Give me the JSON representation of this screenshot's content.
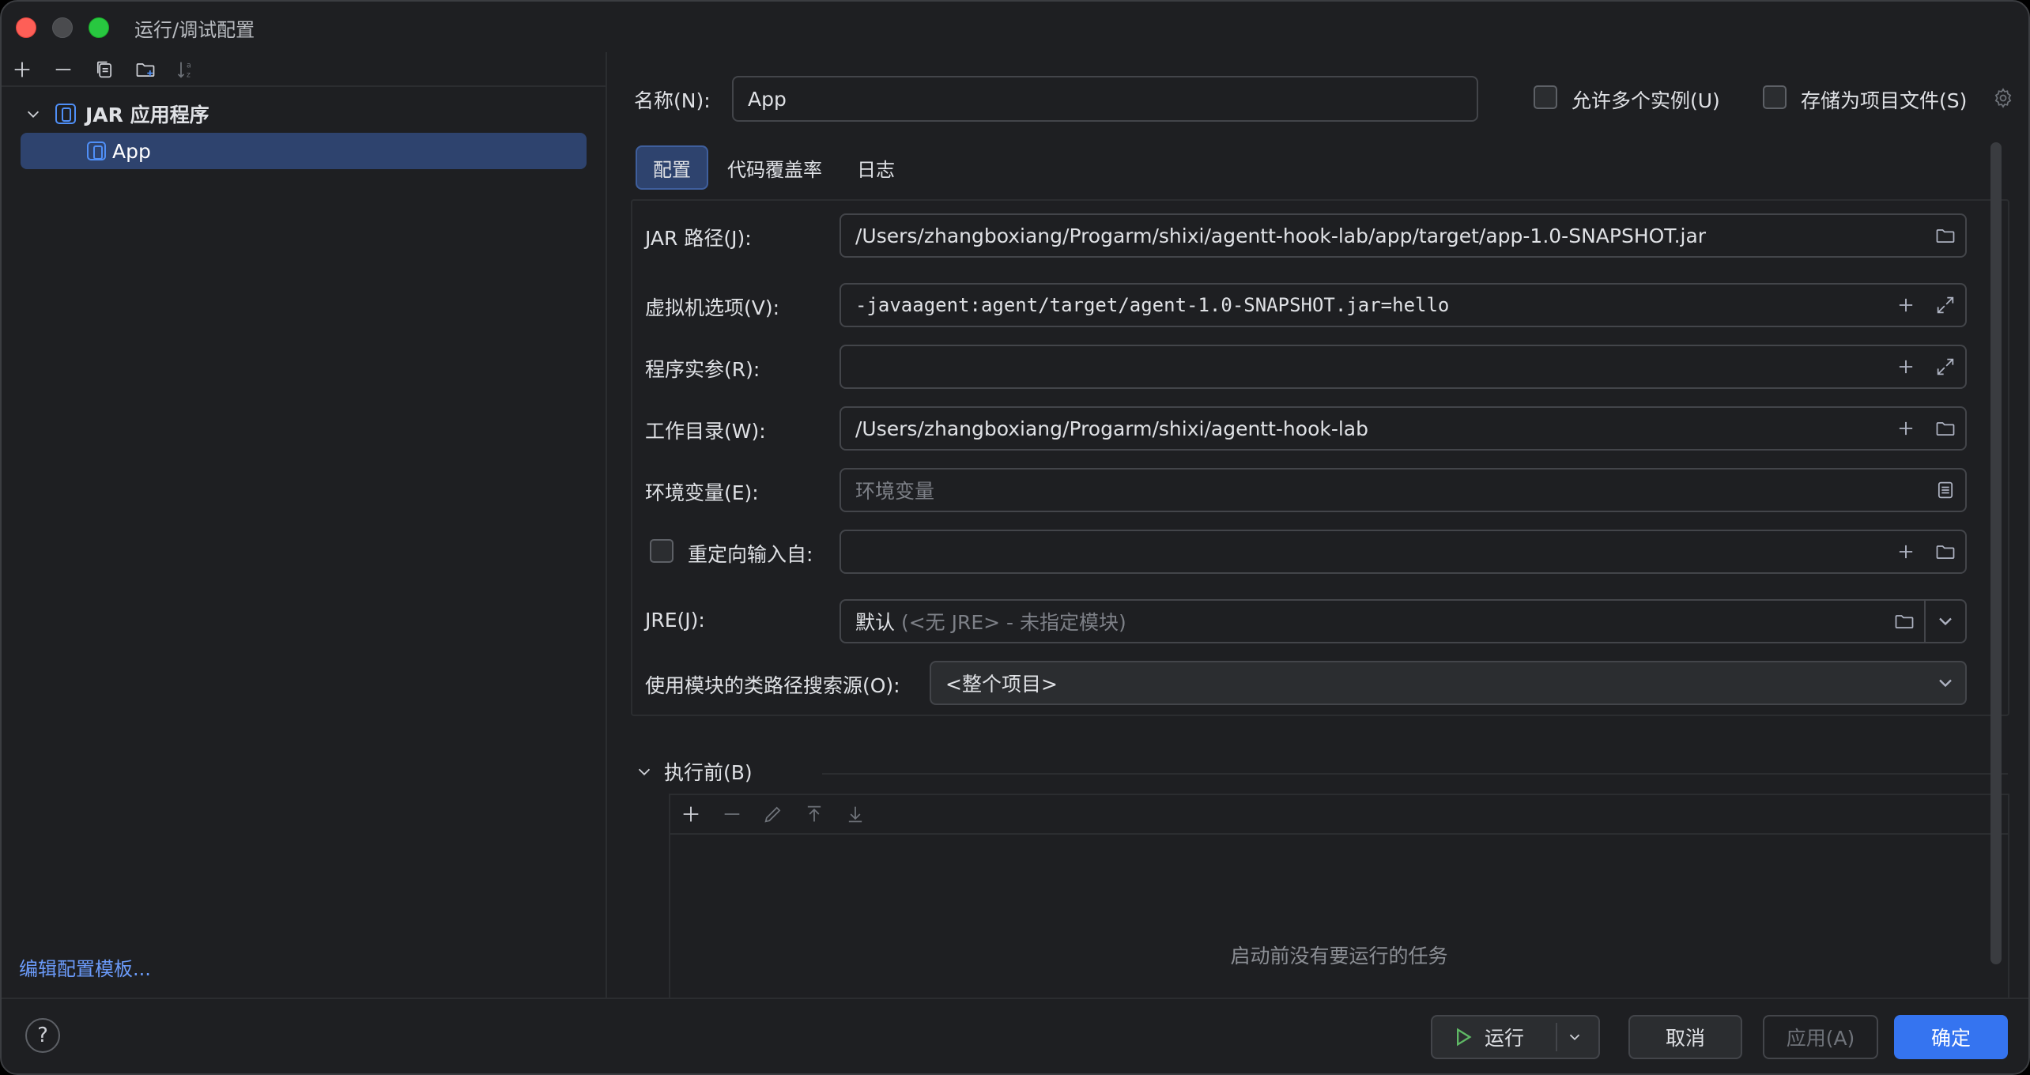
{
  "window": {
    "title": "运行/调试配置"
  },
  "left": {
    "group_label": "JAR 应用程序",
    "selected_item": "App",
    "edit_templates": "编辑配置模板..."
  },
  "form": {
    "name_label": "名称(N):",
    "name_value": "App",
    "allow_multiple_label": "允许多个实例(U)",
    "store_project_label": "存储为项目文件(S)",
    "tabs": [
      "配置",
      "代码覆盖率",
      "日志"
    ],
    "active_tab": "配置",
    "jar_path_label": "JAR 路径(J):",
    "jar_path_value": "/Users/zhangboxiang/Progarm/shixi/agentt-hook-lab/app/target/app-1.0-SNAPSHOT.jar",
    "vm_options_label": "虚拟机选项(V):",
    "vm_options_value": "-javaagent:agent/target/agent-1.0-SNAPSHOT.jar=hello",
    "program_args_label": "程序实参(R):",
    "program_args_value": "",
    "work_dir_label": "工作目录(W):",
    "work_dir_value": "/Users/zhangboxiang/Progarm/shixi/agentt-hook-lab",
    "env_label": "环境变量(E):",
    "env_placeholder": "环境变量",
    "redirect_label": "重定向输入自:",
    "redirect_value": "",
    "jre_label": "JRE(J):",
    "jre_value": "默认",
    "jre_hint": "(<无 JRE> - 未指定模块)",
    "module_label": "使用模块的类路径搜索源(O):",
    "module_value": "<整个项目>"
  },
  "before_launch": {
    "title": "执行前(B)",
    "empty_text": "启动前没有要运行的任务"
  },
  "footer": {
    "help": "?",
    "run": "运行",
    "cancel": "取消",
    "apply": "应用(A)",
    "ok": "确定"
  },
  "colors": {
    "accent": "#3574f0",
    "selection": "#2e436e",
    "link": "#6b9bfa",
    "background": "#1e1f22"
  }
}
